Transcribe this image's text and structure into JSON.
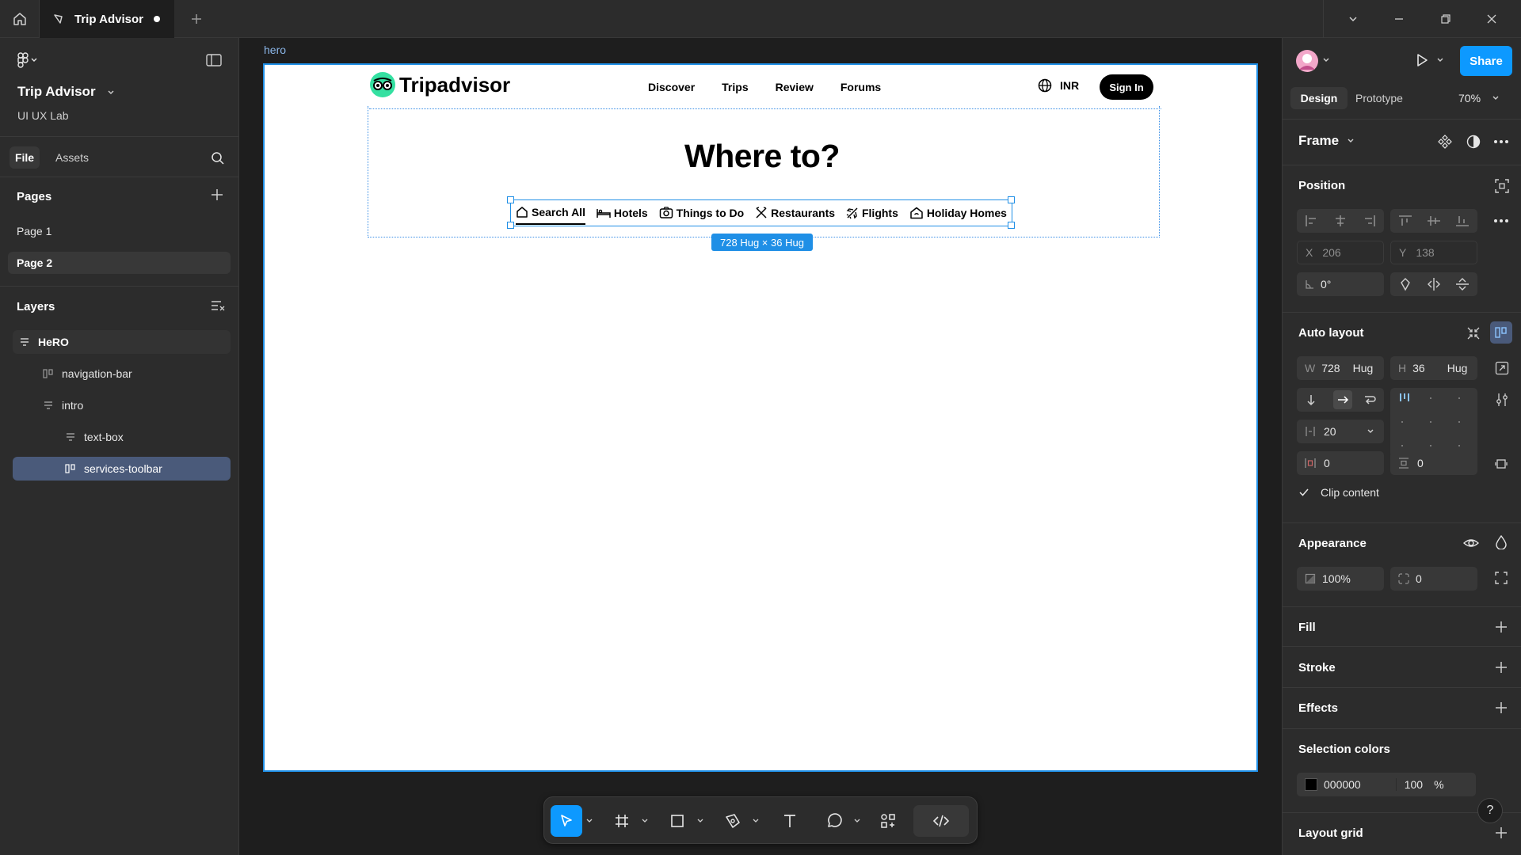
{
  "topbar": {
    "tab_title": "Trip Advisor",
    "icons": [
      "home-icon",
      "plugin-icon",
      "plus-icon",
      "chevron-down-icon",
      "minimize-icon",
      "restore-icon",
      "close-icon"
    ]
  },
  "left_panel": {
    "file_title": "Trip Advisor",
    "team": "UI UX Lab",
    "tabs": {
      "file": "File",
      "assets": "Assets"
    },
    "pages_heading": "Pages",
    "pages": [
      "Page 1",
      "Page 2"
    ],
    "layers_heading": "Layers",
    "layers": [
      {
        "label": "HeRO",
        "type": "frame"
      },
      {
        "label": "navigation-bar",
        "type": "autolayout"
      },
      {
        "label": "intro",
        "type": "frame"
      },
      {
        "label": "text-box",
        "type": "frame"
      },
      {
        "label": "services-toolbar",
        "type": "autolayout",
        "selected": true
      }
    ]
  },
  "canvas": {
    "frame_label": "hero",
    "logo_text": "Tripadvisor",
    "nav_links": [
      "Discover",
      "Trips",
      "Review",
      "Forums"
    ],
    "currency": "INR",
    "sign_in": "Sign In",
    "headline": "Where to?",
    "toolbar_items": [
      "Search All",
      "Hotels",
      "Things to Do",
      "Restaurants",
      "Flights",
      "Holiday Homes"
    ],
    "size_badge": "728 Hug × 36 Hug"
  },
  "right_panel": {
    "share": "Share",
    "tabs": {
      "design": "Design",
      "prototype": "Prototype"
    },
    "zoom": "70%",
    "frame_label": "Frame",
    "position": {
      "heading": "Position",
      "x_label": "X",
      "x": "206",
      "y_label": "Y",
      "y": "138",
      "rotation": "0°"
    },
    "auto_layout": {
      "heading": "Auto layout",
      "w_label": "W",
      "w": "728",
      "w_mode": "Hug",
      "h_label": "H",
      "h": "36",
      "h_mode": "Hug",
      "gap": "20",
      "pad_h": "0",
      "pad_v": "0",
      "clip": "Clip content"
    },
    "appearance": {
      "heading": "Appearance",
      "opacity": "100%",
      "radius": "0"
    },
    "fill": "Fill",
    "stroke": "Stroke",
    "effects": "Effects",
    "selection_colors": {
      "heading": "Selection colors",
      "hex": "000000",
      "opacity": "100",
      "unit": "%"
    },
    "layout_grid": "Layout grid",
    "help": "?"
  },
  "colors": {
    "accent": "#0d99ff",
    "selection": "#1f8fe6",
    "panel": "#2c2c2c",
    "canvas": "#1e1e1e"
  }
}
